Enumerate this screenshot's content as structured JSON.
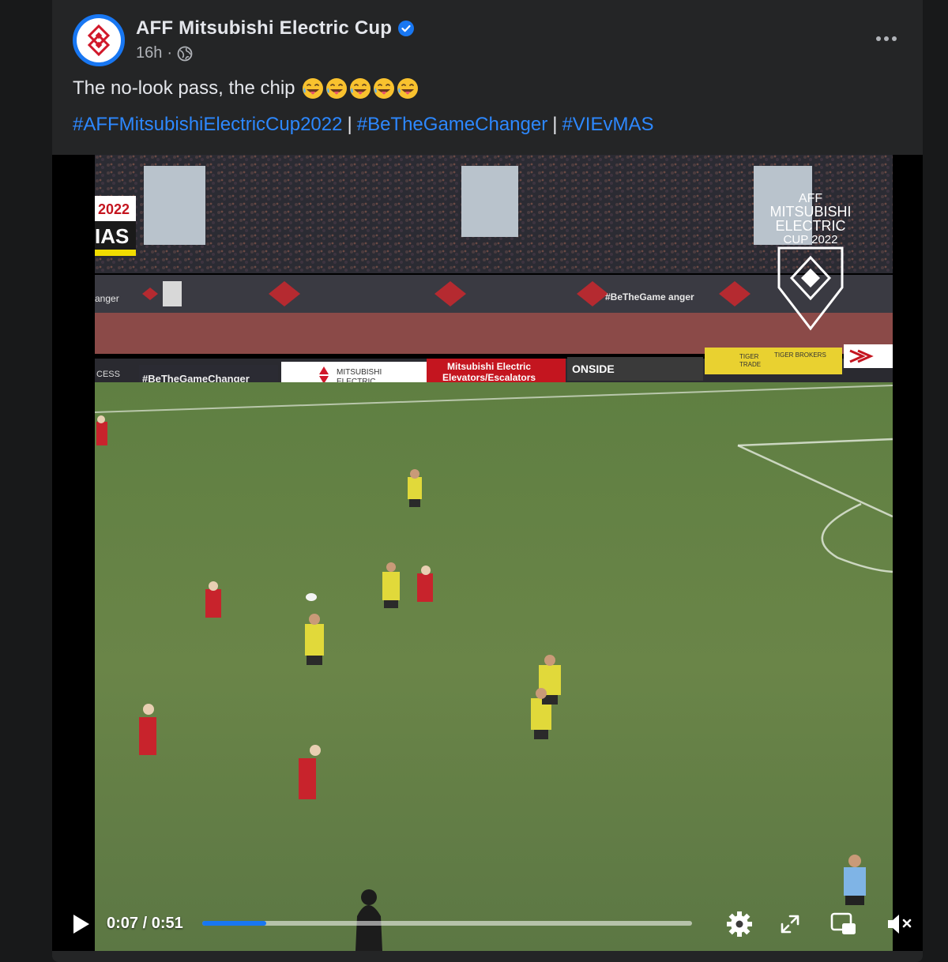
{
  "post": {
    "page_name": "AFF Mitsubishi Electric Cup",
    "verified_icon": "verified-badge-icon",
    "time_ago": "16h",
    "separator": "·",
    "audience_icon": "globe-icon",
    "caption": "The no-look pass, the chip",
    "caption_emoji": "grinning-face-with-tongue-emoji",
    "caption_emoji_count": 5,
    "hashtags": [
      "#AFFMitsubishiElectricCup2022",
      "#BeTheGameChanger",
      "#VIEvMAS"
    ],
    "hashtag_separator": "|",
    "hashtag_color": "#2d88ff"
  },
  "video": {
    "overlay": {
      "score_year": "2022",
      "score_team": "IAS",
      "brand_lines": [
        "AFF",
        "MITSUBISHI",
        "ELECTRIC",
        "CUP 2022"
      ]
    },
    "ads": {
      "hashtag_board": "#BeTheGameChanger",
      "mitsubishi": [
        "MITSUBISHI",
        "ELECTRIC"
      ],
      "elevators": [
        "Mitsubishi Electric",
        "Elevators/Escalators"
      ],
      "onside": "ONSIDE",
      "tiger": [
        "TIGER",
        "TRADE"
      ],
      "tiger_brokers": "TIGER BROKERS",
      "upper_hashtag": "#BeTheGame  anger",
      "left_fragment": "anger",
      "access_fragment": "CESS"
    },
    "controls": {
      "current_time": "0:07",
      "duration": "0:51",
      "time_separator": "/",
      "progress": 0.13,
      "play_icon": "play-icon",
      "settings_icon": "gear-icon",
      "fullscreen_icon": "fullscreen-icon",
      "pip_icon": "picture-in-picture-icon",
      "mute_icon": "muted-speaker-icon"
    }
  }
}
